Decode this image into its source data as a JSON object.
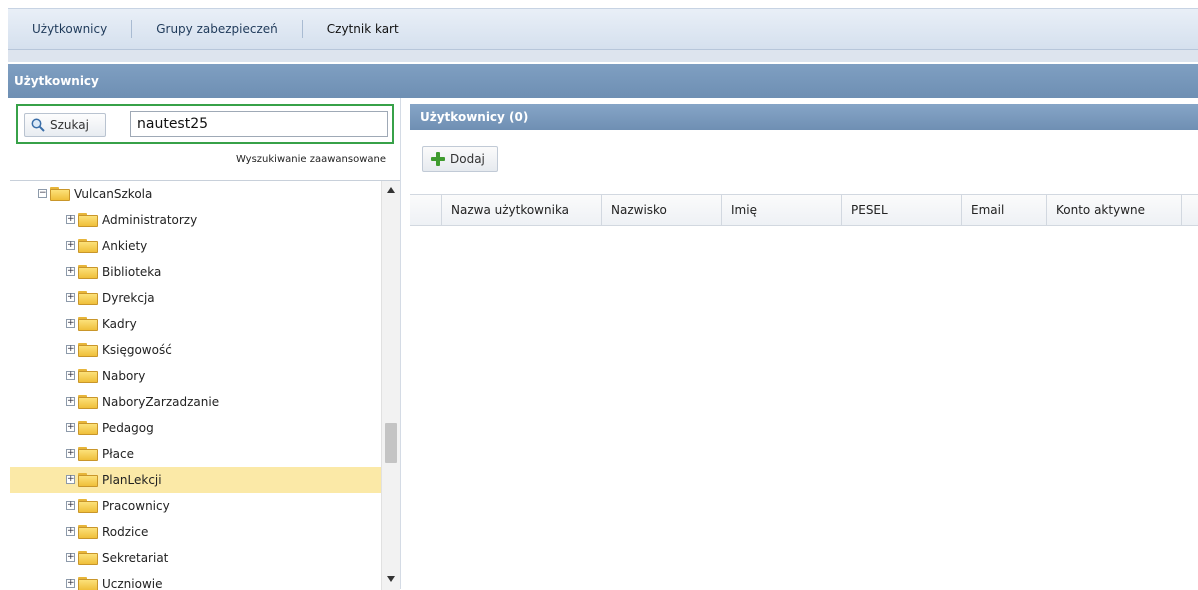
{
  "top_tabs": [
    "Użytkownicy",
    "Grupy zabezpieczeń",
    "Czytnik kart"
  ],
  "section_title": "Użytkownicy",
  "search": {
    "button_label": "Szukaj",
    "value": "nautest25",
    "advanced_link": "Wyszukiwanie zaawansowane"
  },
  "tree": {
    "root": "VulcanSzkola",
    "items": [
      "Administratorzy",
      "Ankiety",
      "Biblioteka",
      "Dyrekcja",
      "Kadry",
      "Księgowość",
      "Nabory",
      "NaboryZarzadzanie",
      "Pedagog",
      "Płace",
      "PlanLekcji",
      "Pracownicy",
      "Rodzice",
      "Sekretariat",
      "Uczniowie"
    ],
    "selected": "PlanLekcji"
  },
  "users_panel": {
    "title": "Użytkownicy (0)",
    "add_label": "Dodaj",
    "columns": [
      "Nazwa użytkownika",
      "Nazwisko",
      "Imię",
      "PESEL",
      "Email",
      "Konto aktywne"
    ]
  },
  "colors": {
    "header_blue": "#7393b8",
    "search_border": "#37a148",
    "selected_row": "#fbe9a7"
  }
}
